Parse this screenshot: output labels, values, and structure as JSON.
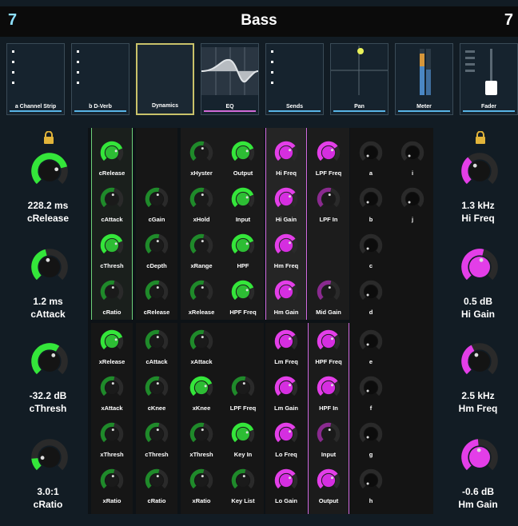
{
  "header": {
    "channel_number": "7",
    "title": "Bass",
    "channel_number_right": "7"
  },
  "tabs": [
    {
      "label": "a Channel Strip",
      "color": "#58b4e6"
    },
    {
      "label": "b D-Verb",
      "color": "#58b4e6"
    },
    {
      "label": "Dynamics",
      "color": "#c9c26a"
    },
    {
      "label": "EQ",
      "color": "#d06bd8"
    },
    {
      "label": "Sends",
      "color": "#58b4e6"
    },
    {
      "label": "Pan",
      "color": "#58b4e6"
    },
    {
      "label": "Meter",
      "color": "#58b4e6"
    },
    {
      "label": "Fader",
      "color": "#58b4e6"
    }
  ],
  "colors": {
    "green": "#34e63a",
    "dark_green": "#1f8a2a",
    "magenta": "#e33ee8",
    "dark_magenta": "#8a2a8f",
    "knob_body": "#1a1a1a"
  },
  "left_params": [
    {
      "value": "228.2 ms",
      "name": "cRelease",
      "level": 0.78
    },
    {
      "value": "1.2 ms",
      "name": "cAttack",
      "level": 0.45
    },
    {
      "value": "-32.2 dB",
      "name": "cThresh",
      "level": 0.62
    },
    {
      "value": "3.0:1",
      "name": "cRatio",
      "level": 0.15
    }
  ],
  "right_params": [
    {
      "value": "1.3 kHz",
      "name": "Hi Freq",
      "level": 0.35
    },
    {
      "value": "0.5 dB",
      "name": "Hi Gain",
      "level": 0.55
    },
    {
      "value": "2.5 kHz",
      "name": "Hm Freq",
      "level": 0.4
    },
    {
      "value": "-0.6 dB",
      "name": "Hm Gain",
      "level": 0.48
    }
  ],
  "grid": [
    [
      {
        "label": "cRelease",
        "color": "green"
      },
      {
        "label": "",
        "color": "none"
      },
      {
        "label": "xHyster",
        "color": "dgreen"
      },
      {
        "label": "Output",
        "color": "green"
      },
      {
        "label": "Hi Freq",
        "color": "magenta"
      },
      {
        "label": "LPF Freq",
        "color": "magenta"
      },
      {
        "label": "a",
        "color": "dark"
      },
      {
        "label": "i",
        "color": "dark"
      }
    ],
    [
      {
        "label": "cAttack",
        "color": "dgreen"
      },
      {
        "label": "cGain",
        "color": "dgreen"
      },
      {
        "label": "xHold",
        "color": "dgreen"
      },
      {
        "label": "Input",
        "color": "green"
      },
      {
        "label": "Hi Gain",
        "color": "magenta"
      },
      {
        "label": "LPF In",
        "color": "dmagenta"
      },
      {
        "label": "b",
        "color": "dark"
      },
      {
        "label": "j",
        "color": "dark"
      }
    ],
    [
      {
        "label": "cThresh",
        "color": "green"
      },
      {
        "label": "cDepth",
        "color": "dgreen"
      },
      {
        "label": "xRange",
        "color": "dgreen"
      },
      {
        "label": "HPF",
        "color": "green"
      },
      {
        "label": "Hm Freq",
        "color": "magenta"
      },
      {
        "label": "",
        "color": "none"
      },
      {
        "label": "c",
        "color": "dark"
      },
      {
        "label": "",
        "color": "none"
      }
    ],
    [
      {
        "label": "cRatio",
        "color": "dgreen"
      },
      {
        "label": "cRelease",
        "color": "dgreen"
      },
      {
        "label": "xRelease",
        "color": "dgreen"
      },
      {
        "label": "HPF Freq",
        "color": "green"
      },
      {
        "label": "Hm Gain",
        "color": "magenta"
      },
      {
        "label": "Mid Gain",
        "color": "dmagenta"
      },
      {
        "label": "d",
        "color": "dark"
      },
      {
        "label": "",
        "color": "none"
      }
    ],
    [
      {
        "label": "xRelease",
        "color": "green"
      },
      {
        "label": "cAttack",
        "color": "dgreen"
      },
      {
        "label": "xAttack",
        "color": "dgreen"
      },
      {
        "label": "",
        "color": "none"
      },
      {
        "label": "Lm Freq",
        "color": "magenta"
      },
      {
        "label": "HPF Freq",
        "color": "magenta"
      },
      {
        "label": "e",
        "color": "dark"
      },
      {
        "label": "",
        "color": "none"
      }
    ],
    [
      {
        "label": "xAttack",
        "color": "dgreen"
      },
      {
        "label": "cKnee",
        "color": "dgreen"
      },
      {
        "label": "xKnee",
        "color": "green"
      },
      {
        "label": "LPF Freq",
        "color": "dgreen"
      },
      {
        "label": "Lm Gain",
        "color": "magenta"
      },
      {
        "label": "HPF In",
        "color": "magenta"
      },
      {
        "label": "f",
        "color": "dark"
      },
      {
        "label": "",
        "color": "none"
      }
    ],
    [
      {
        "label": "xThresh",
        "color": "dgreen"
      },
      {
        "label": "cThresh",
        "color": "dgreen"
      },
      {
        "label": "xThresh",
        "color": "dgreen"
      },
      {
        "label": "Key In",
        "color": "green"
      },
      {
        "label": "Lo Freq",
        "color": "magenta"
      },
      {
        "label": "Input",
        "color": "dmagenta"
      },
      {
        "label": "g",
        "color": "dark"
      },
      {
        "label": "",
        "color": "none"
      }
    ],
    [
      {
        "label": "xRatio",
        "color": "dgreen"
      },
      {
        "label": "cRatio",
        "color": "dgreen"
      },
      {
        "label": "xRatio",
        "color": "dgreen"
      },
      {
        "label": "Key List",
        "color": "dgreen"
      },
      {
        "label": "Lo Gain",
        "color": "magenta"
      },
      {
        "label": "Output",
        "color": "magenta"
      },
      {
        "label": "h",
        "color": "dark"
      },
      {
        "label": "",
        "color": "none"
      }
    ]
  ]
}
